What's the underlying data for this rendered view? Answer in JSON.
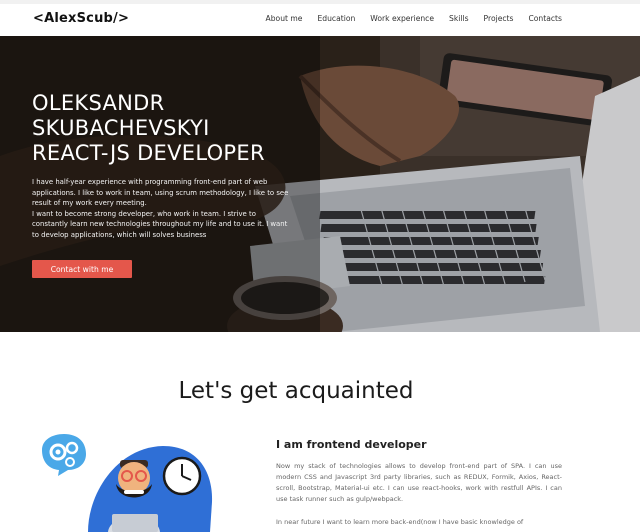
{
  "header": {
    "logo": "<AlexScub/>",
    "nav": [
      "About me",
      "Education",
      "Work experience",
      "Skills",
      "Projects",
      "Contacts"
    ]
  },
  "hero": {
    "title_lines": [
      "OLEKSANDR",
      "SKUBACHEVSKYI",
      "REACT-JS DEVELOPER"
    ],
    "paragraph1": "I have half-year experience with programming front-end part of web applications. I like to work in team, using scrum methodology, I like to see result of my work every meeting.",
    "paragraph2": "I want to become strong developer, who work in team. I strive to constantly learn new technologies throughout my life and to use it. I want to develop applications, which will solves business",
    "button": "Contact with me"
  },
  "about": {
    "title": "Let's get acquainted",
    "heading": "I am frontend developer",
    "paragraph1": "Now my stack of technologies allows to develop front-end part of SPA. I can use modern CSS and Javascript 3rd party libraries, such as REDUX, Formik, Axios, React-scroll, Bootstrap, Material-ui etc. I can use react-hooks, work with restfull APIs. I can use task runner such as gulp/webpack.",
    "paragraph2": "In near future I want to learn more back-end(now I have basic knowledge of"
  },
  "colors": {
    "accent": "#e4574b",
    "illustration_blue": "#2f6fd6",
    "illustration_light_blue": "#4aa8e8"
  }
}
